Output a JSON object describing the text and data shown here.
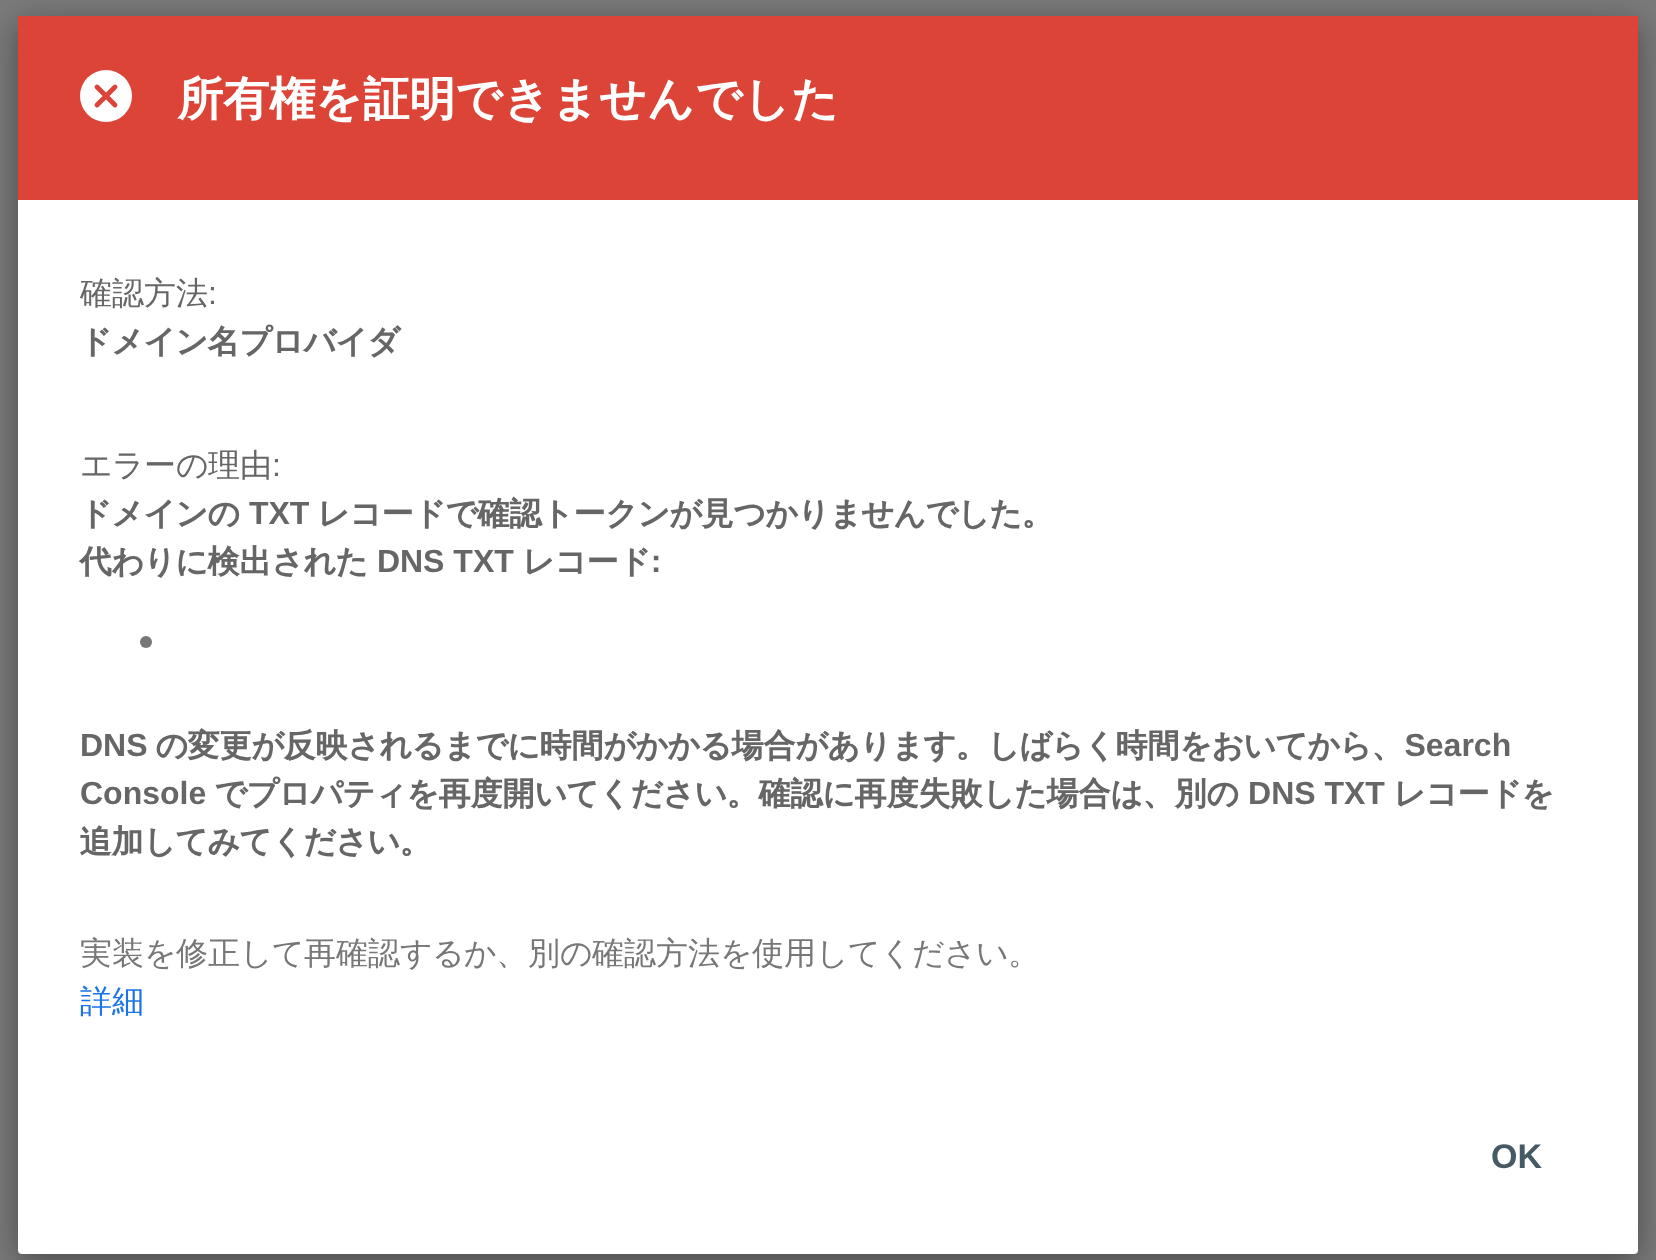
{
  "dialog": {
    "kind": "error",
    "title": "所有権を証明できませんでした",
    "sections": [
      {
        "label": "確認方法:",
        "lines": [
          "ドメイン名プロバイダ"
        ],
        "bullet": false
      },
      {
        "label": "エラーの理由:",
        "lines": [
          "ドメインの TXT レコードで確認トークンが見つかりませんでした。",
          "代わりに検出された DNS TXT レコード:"
        ],
        "bullet": true
      }
    ],
    "note": "DNS の変更が反映されるまでに時間がかかる場合があります。しばらく時間をおいてから、Search Console でプロパティを再度開いてください。確認に再度失敗した場合は、別の DNS TXT レコードを追加してみてください。",
    "hint": "実装を修正して再確認するか、別の確認方法を使用してください。",
    "link": "詳細",
    "buttons": [
      "OK"
    ]
  }
}
